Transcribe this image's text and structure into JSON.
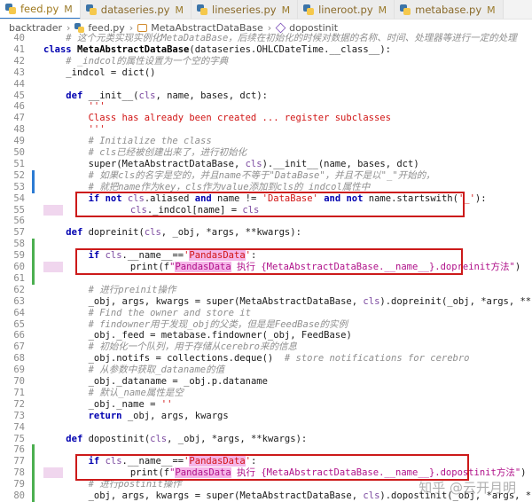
{
  "tabs": [
    {
      "name": "feed.py",
      "status": "M",
      "active": true
    },
    {
      "name": "dataseries.py",
      "status": "M",
      "active": false
    },
    {
      "name": "lineseries.py",
      "status": "M",
      "active": false
    },
    {
      "name": "lineroot.py",
      "status": "M",
      "active": false
    },
    {
      "name": "metabase.py",
      "status": "M",
      "active": false
    }
  ],
  "breadcrumb": {
    "items": [
      "backtrader",
      "feed.py",
      "MetaAbstractDataBase",
      "dopostinit"
    ],
    "separator": "›"
  },
  "editor": {
    "lines": [
      {
        "num": "40",
        "text": "    # 这个元类实现实例化MetaDataBase，后续在初始化的时候对数据的名称、时间、处理器等进行一定的处理"
      },
      {
        "num": "41",
        "text": "class MetaAbstractDataBase(dataseries.OHLCDateTime.__class__):"
      },
      {
        "num": "42",
        "text": "    # _indcol的属性设置为一个空的字典"
      },
      {
        "num": "43",
        "text": "    _indcol = dict()"
      },
      {
        "num": "44",
        "text": ""
      },
      {
        "num": "45",
        "text": "    def __init__(cls, name, bases, dct):"
      },
      {
        "num": "46",
        "text": "        '''"
      },
      {
        "num": "47",
        "text": "        Class has already been created ... register subclasses"
      },
      {
        "num": "48",
        "text": "        '''"
      },
      {
        "num": "49",
        "text": "        # Initialize the class"
      },
      {
        "num": "50",
        "text": "        # cls已经被创建出来了，进行初始化"
      },
      {
        "num": "51",
        "text": "        super(MetaAbstractDataBase, cls).__init__(name, bases, dct)"
      },
      {
        "num": "52",
        "text": "        # 如果cls的名字是空的，并且name不等于\"DataBase\"，并且不是以\"_\"开始的，"
      },
      {
        "num": "53",
        "text": "        # 就把name作为key，cls作为value添加到cls的_indcol属性中"
      },
      {
        "num": "54",
        "text": "        if not cls.aliased and name != 'DataBase' and not name.startswith('_'):"
      },
      {
        "num": "55",
        "text": "            cls._indcol[name] = cls"
      },
      {
        "num": "56",
        "text": ""
      },
      {
        "num": "57",
        "text": "    def dopreinit(cls, _obj, *args, **kwargs):"
      },
      {
        "num": "58",
        "text": ""
      },
      {
        "num": "59",
        "text": "        if cls.__name__=='PandasData':"
      },
      {
        "num": "60",
        "text": "            print(f\"PandasData 执行 {MetaAbstractDataBase.__name__}.dopreinit方法\")"
      },
      {
        "num": "61",
        "text": ""
      },
      {
        "num": "62",
        "text": "        # 进行preinit操作"
      },
      {
        "num": "63",
        "text": "        _obj, args, kwargs = super(MetaAbstractDataBase, cls).dopreinit(_obj, *args, **kwargs)"
      },
      {
        "num": "64",
        "text": "        # Find the owner and store it"
      },
      {
        "num": "65",
        "text": "        # findowner用于发现_obj的父类，但是是FeedBase的实例"
      },
      {
        "num": "66",
        "text": "        _obj._feed = metabase.findowner(_obj, FeedBase)"
      },
      {
        "num": "67",
        "text": "        # 初始化一个队列，用于存储从cerebro来的信息"
      },
      {
        "num": "68",
        "text": "        _obj.notifs = collections.deque()  # store notifications for cerebro"
      },
      {
        "num": "69",
        "text": "        # 从参数中获取_dataname的值"
      },
      {
        "num": "70",
        "text": "        _obj._dataname = _obj.p.dataname"
      },
      {
        "num": "71",
        "text": "        # 默认_name属性是空"
      },
      {
        "num": "72",
        "text": "        _obj._name = ''"
      },
      {
        "num": "73",
        "text": "        return _obj, args, kwargs"
      },
      {
        "num": "74",
        "text": ""
      },
      {
        "num": "75",
        "text": "    def dopostinit(cls, _obj, *args, **kwargs):"
      },
      {
        "num": "76",
        "text": ""
      },
      {
        "num": "77",
        "text": "        if cls.__name__=='PandasData':"
      },
      {
        "num": "78",
        "text": "            print(f\"PandasData 执行 {MetaAbstractDataBase.__name__}.dopostinit方法\")"
      },
      {
        "num": "79",
        "text": "        # 进行postinit操作"
      },
      {
        "num": "80",
        "text": "        _obj, args, kwargs = super(MetaAbstractDataBase, cls).dopostinit(_obj, *args, **kwargs)"
      }
    ]
  },
  "watermark": "知乎 @云开月明",
  "colors": {
    "highlight_box": "#cc1a1a",
    "active_tab_border": "#2a75c8",
    "keyword": "#0000b0",
    "string": "#b0128a",
    "comment": "#8f8f8f"
  }
}
